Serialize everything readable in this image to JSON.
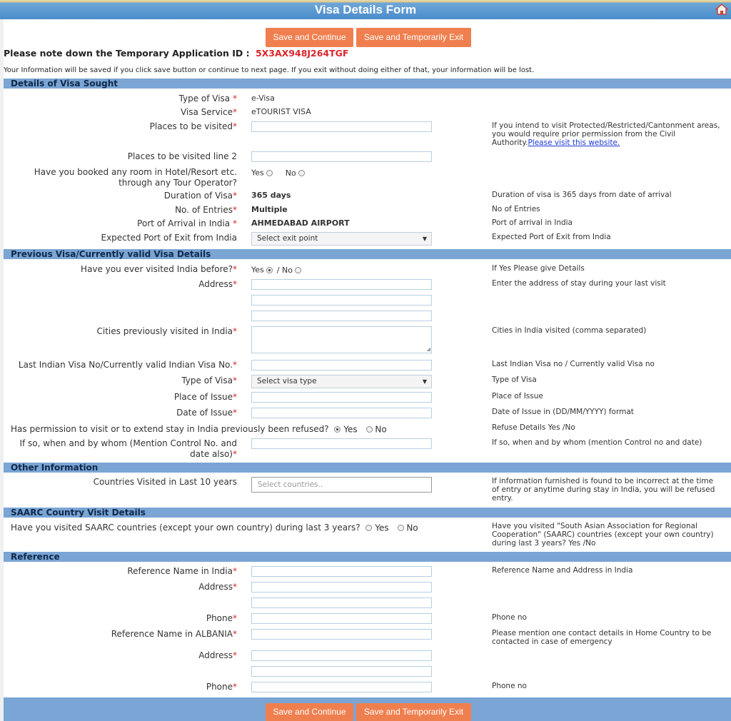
{
  "page_title": "Visa Details Form",
  "buttons": {
    "save_continue": "Save and Continue",
    "save_exit": "Save and Temporarily Exit"
  },
  "temp_id": {
    "label": "Please note down the Temporary Application ID :",
    "value": "5X3AX948J264TGF"
  },
  "info_note": "Your Information will be saved if you click save button or continue to next page. If you exit without doing either of that, your information will be lost.",
  "sections": {
    "visa_sought": "Details of Visa Sought",
    "previous_visa": "Previous Visa/Currently valid Visa Details",
    "other_info": "Other Information",
    "saarc": "SAARC Country Visit Details",
    "reference": "Reference"
  },
  "visa_sought": {
    "type_label": "Type of Visa",
    "type_value": "e-Visa",
    "service_label": "Visa Service",
    "service_value": "eTOURIST VISA",
    "places_label": "Places to be visited",
    "places_help": "If you intend to visit Protected/Restricted/Cantonment areas, you would require prior permission from the Civil Authority.",
    "places_help_link": "Please visit this website.",
    "places2_label": "Places to be visited line 2",
    "hotel_label_1": "Have you booked any room in Hotel/Resort etc.",
    "hotel_label_2": "through any Tour Operator?",
    "yes": "Yes",
    "no": "No",
    "duration_label": "Duration of Visa",
    "duration_value": "365 days",
    "duration_help": "Duration of visa is 365 days from date of arrival",
    "entries_label": "No. of Entries",
    "entries_value": "Multiple",
    "entries_help": "No of Entries",
    "port_arrival_label": "Port of Arrival in India",
    "port_arrival_value": "AHMEDABAD AIRPORT",
    "port_arrival_help": "Port of arrival in India",
    "port_exit_label": "Expected Port of Exit from India",
    "port_exit_select": "Select exit point",
    "port_exit_help": "Expected Port of Exit from India"
  },
  "previous_visa": {
    "visited_label": "Have you ever visited India before?",
    "visited_yes": "Yes",
    "visited_no": "/ No",
    "visited_help": "If Yes Please give Details",
    "address_label": "Address",
    "address_help": "Enter the address of stay during your last visit",
    "cities_label": "Cities previously visited in India",
    "cities_help": "Cities in India visited (comma separated)",
    "last_visa_label": "Last Indian Visa No/Currently valid Indian Visa No.",
    "last_visa_help": "Last Indian Visa no / Currently valid Visa no",
    "type_label": "Type of Visa",
    "type_select": "Select visa type",
    "type_help": "Type of Visa",
    "place_issue_label": "Place of Issue",
    "place_issue_help": "Place of Issue",
    "date_issue_label": "Date of Issue",
    "date_issue_help": "Date of Issue in (DD/MM/YYYY) format",
    "refused_label": "Has permission to visit or to extend stay in India previously been refused?",
    "refused_yes": "Yes",
    "refused_no": "No",
    "refused_help": "Refuse Details Yes /No",
    "whom_label_1": "If so, when and by whom (Mention Control No. and",
    "whom_label_2": "date also)",
    "whom_help": "If so, when and by whom (mention Control no and date)"
  },
  "other_info": {
    "countries_label": "Countries Visited in Last 10 years",
    "countries_placeholder": "Select countries..",
    "countries_help": "If information furnished is found to be incorrect at the time of entry or anytime during stay in India, you will be refused entry."
  },
  "saarc": {
    "question": "Have you visited SAARC countries (except your own country) during last 3 years?",
    "yes": "Yes",
    "no": "No",
    "help": "Have you visited \"South Asian Association for Regional Cooperation\" (SAARC) countries (except your own country) during last 3 years? Yes /No"
  },
  "reference": {
    "name_india_label": "Reference Name in India",
    "name_india_help": "Reference Name and Address in India",
    "address_label": "Address",
    "phone_label": "Phone",
    "phone_help": "Phone no",
    "name_home_label": "Reference Name in ALBANIA",
    "name_home_help": "Please mention one contact details in Home Country to be contacted in case of emergency",
    "address2_label": "Address",
    "phone2_label": "Phone",
    "phone2_help": "Phone no"
  },
  "icons": {
    "home": "home-icon",
    "dropdown": "chevron-down-icon"
  },
  "colors": {
    "header_blue": "#4a8ccb",
    "section_blue": "#7aa5d4",
    "button_orange": "#f07f4f",
    "required_red": "#d9262b",
    "temp_id_red": "#d9262b"
  }
}
